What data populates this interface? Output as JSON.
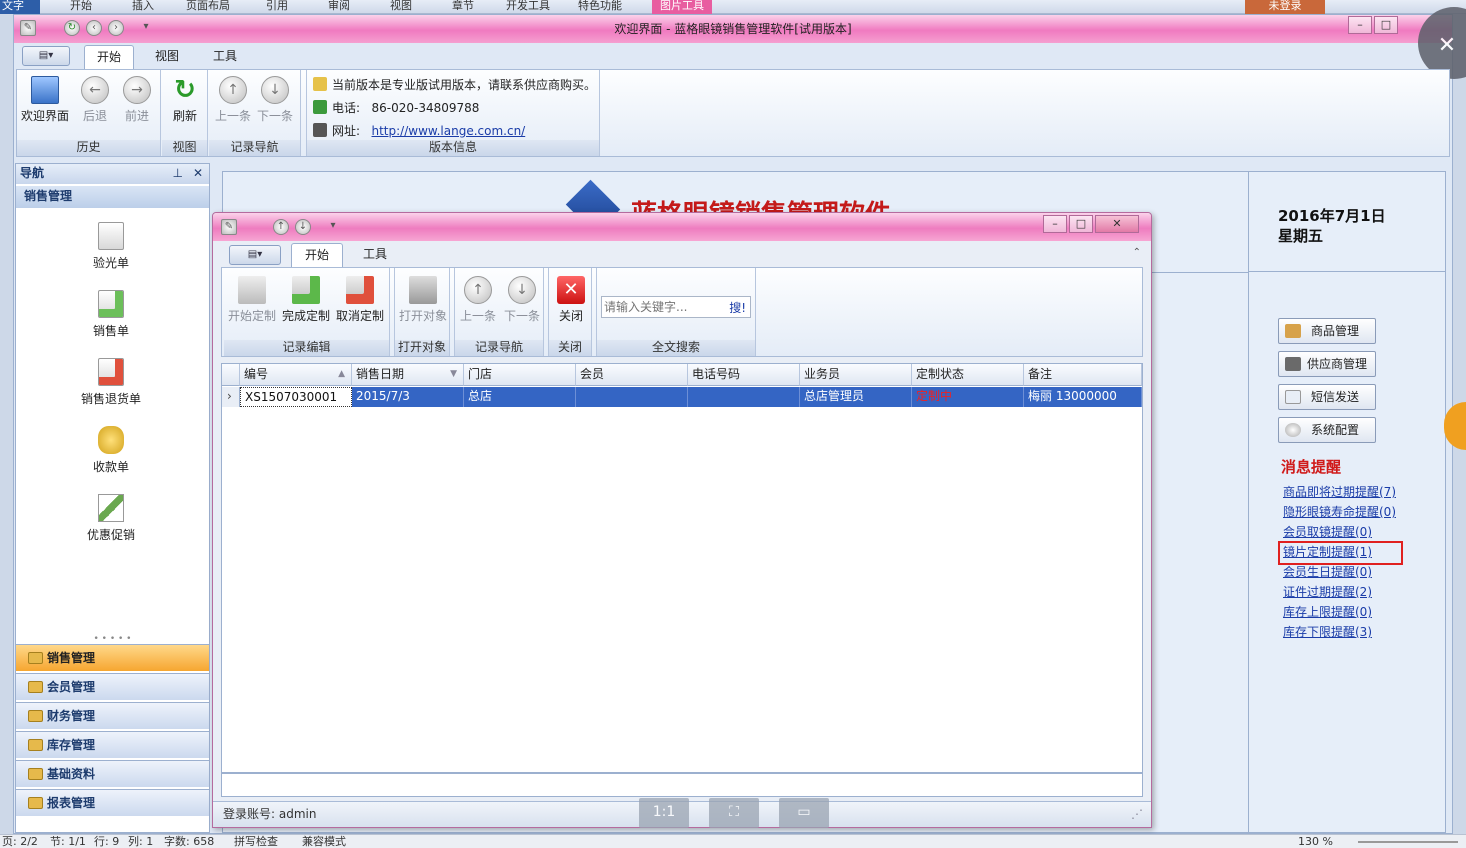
{
  "background_app": {
    "left_tab": "文字",
    "menu": [
      "开始",
      "插入",
      "页面布局",
      "引用",
      "审阅",
      "视图",
      "章节",
      "开发工具",
      "特色功能"
    ],
    "pink_tab": "图片工具",
    "login": "未登录",
    "status": {
      "page": "页: 2/2",
      "section": "节: 1/1",
      "line": "行: 9",
      "col": "列: 1",
      "words": "字数: 658",
      "spell": "拼写检查",
      "compat": "兼容模式",
      "zoom": "130 %"
    }
  },
  "window": {
    "title": "欢迎界面 - 蓝格眼镜销售管理软件[试用版本]",
    "tabs": [
      "开始",
      "视图",
      "工具"
    ],
    "ribbon": {
      "groups": [
        {
          "label": "历史",
          "buttons": [
            "欢迎界面",
            "后退",
            "前进"
          ]
        },
        {
          "label": "视图",
          "buttons": [
            "刷新"
          ]
        },
        {
          "label": "记录导航",
          "buttons": [
            "上一条",
            "下一条"
          ]
        },
        {
          "label": "版本信息"
        }
      ],
      "notice": "当前版本是专业版试用版本，请联系供应商购买。",
      "phone_label": "电话:",
      "phone": "86-020-34809788",
      "site_label": "网址:",
      "site": "http://www.lange.com.cn/"
    }
  },
  "nav": {
    "title": "导航",
    "section": "销售管理",
    "items": [
      "验光单",
      "销售单",
      "销售退货单",
      "收款单",
      "优惠促销"
    ],
    "groups": [
      "销售管理",
      "会员管理",
      "财务管理",
      "库存管理",
      "基础资料",
      "报表管理"
    ]
  },
  "welcome": {
    "logo_text": "蓝格眼镜销售管理软件",
    "date": "2016年7月1日",
    "weekday": "星期五",
    "side_buttons": [
      "商品管理",
      "供应商管理",
      "短信发送",
      "系统配置"
    ],
    "msg_title": "消息提醒",
    "messages": [
      "商品即将过期提醒(7)",
      "隐形眼镜寿命提醒(0)",
      "会员取镜提醒(0)",
      "镜片定制提醒(1)",
      "会员生日提醒(0)",
      "证件过期提醒(2)",
      "库存上限提醒(0)",
      "库存下限提醒(3)"
    ]
  },
  "child": {
    "tabs": [
      "开始",
      "工具"
    ],
    "groups": [
      {
        "label": "记录编辑",
        "buttons": [
          "开始定制",
          "完成定制",
          "取消定制"
        ]
      },
      {
        "label": "打开对象",
        "buttons": [
          "打开对象"
        ]
      },
      {
        "label": "记录导航",
        "buttons": [
          "上一条",
          "下一条"
        ]
      },
      {
        "label": "关闭",
        "buttons": [
          "关闭"
        ]
      },
      {
        "label": "全文搜索"
      }
    ],
    "search_placeholder": "请输入关键字...",
    "search_btn": "搜!",
    "columns": [
      "编号",
      "销售日期",
      "门店",
      "会员",
      "电话号码",
      "业务员",
      "定制状态",
      "备注"
    ],
    "rows": [
      [
        "XS1507030001",
        "2015/7/3",
        "总店",
        "",
        "",
        "总店管理员",
        "定制中",
        "梅丽 13000000"
      ]
    ],
    "status": "登录账号: admin",
    "overlay": [
      "1:1",
      "",
      ""
    ]
  }
}
